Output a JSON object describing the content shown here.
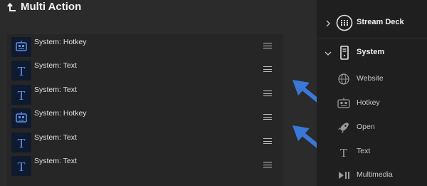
{
  "header": {
    "title": "Multi Action",
    "back_icon": "corner-up-arrow-icon"
  },
  "actions": [
    {
      "label": "System: Hotkey",
      "icon": "robot-keyboard-icon"
    },
    {
      "label": "System: Text",
      "icon": "text-T-icon"
    },
    {
      "label": "System: Text",
      "icon": "text-T-icon"
    },
    {
      "label": "System: Hotkey",
      "icon": "robot-keyboard-icon"
    },
    {
      "label": "System: Text",
      "icon": "text-T-icon"
    },
    {
      "label": "System: Text",
      "icon": "text-T-icon"
    }
  ],
  "sidebar": {
    "categories": [
      {
        "label": "Stream Deck",
        "expanded": false,
        "icon": "stream-deck-grid-icon"
      },
      {
        "label": "System",
        "expanded": true,
        "icon": "system-tower-icon"
      }
    ],
    "items": [
      {
        "label": "Website",
        "icon": "globe-icon"
      },
      {
        "label": "Hotkey",
        "icon": "robot-icon"
      },
      {
        "label": "Open",
        "icon": "rocket-icon"
      },
      {
        "label": "Text",
        "icon": "text-T-icon"
      },
      {
        "label": "Multimedia",
        "icon": "play-pause-icon"
      }
    ]
  },
  "colors": {
    "accent_blue": "#4a86e8",
    "arrow_blue": "#3a78d8",
    "panel_bg": "#2b2b2b",
    "sidebar_bg": "#1f1f1f",
    "icon_bg": "#101a2e"
  }
}
